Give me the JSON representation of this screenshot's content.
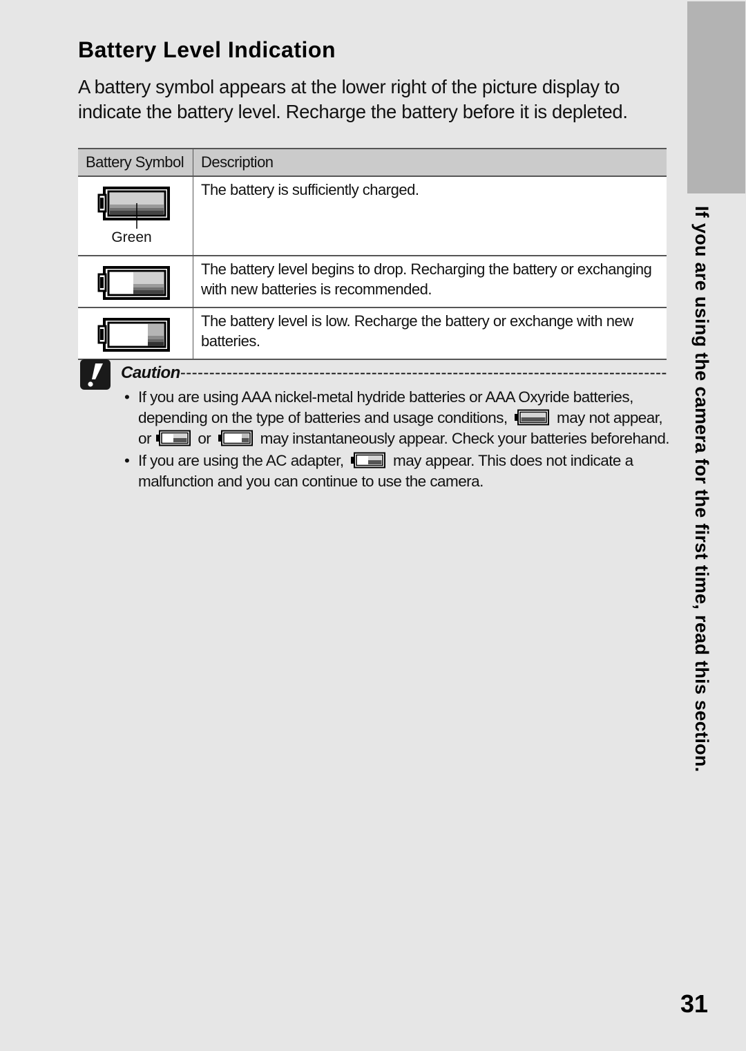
{
  "page": {
    "title": "Battery Level Indication",
    "intro": "A battery symbol appears at the lower right of the picture display to indicate the battery level. Recharge the battery before it is depleted.",
    "page_number": "31",
    "side_tab_text": "If you are using the camera for the first time, read this section."
  },
  "table": {
    "headers": [
      "Battery Symbol",
      "Description"
    ],
    "rows": [
      {
        "icon": "battery-full-icon",
        "level": 1.0,
        "symbol_label": "Green",
        "description": "The battery is sufficiently charged."
      },
      {
        "icon": "battery-half-icon",
        "level": 0.6,
        "symbol_label": "",
        "description": "The battery level begins to drop. Recharging the battery or exchanging with new batteries is recommended."
      },
      {
        "icon": "battery-low-icon",
        "level": 0.3,
        "symbol_label": "",
        "description": "The battery level is low. Recharge the battery or exchange with new batteries."
      }
    ]
  },
  "caution": {
    "icon": "caution-exclamation-icon",
    "heading": "Caution",
    "dashes": "-----------------------------------------------------------------------------------------------------",
    "bullet": "•",
    "items": [
      {
        "part1": "If you are using AAA nickel-metal hydride batteries or AAA Oxyride batteries, depending on the type of batteries and usage conditions,",
        "part2": "may not appear, or",
        "part3": "or",
        "part4": "may instantaneously appear. Check your batteries beforehand."
      },
      {
        "part1": "If you are using the AC adapter,",
        "part2": "may appear. This does not indicate a malfunction and you can continue to use the camera."
      }
    ]
  },
  "colors": {
    "page_background": "#e6e6e6",
    "table_header": "#cbcbcb",
    "side_tab": "#b3b3b3"
  }
}
